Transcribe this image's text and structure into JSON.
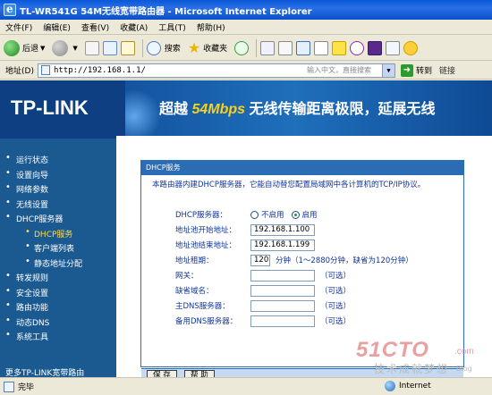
{
  "window": {
    "title": "TL-WR541G 54M无线宽带路由器 - Microsoft Internet Explorer"
  },
  "menubar": {
    "items": [
      {
        "label": "文件(F)"
      },
      {
        "label": "编辑(E)"
      },
      {
        "label": "查看(V)"
      },
      {
        "label": "收藏(A)"
      },
      {
        "label": "工具(T)"
      },
      {
        "label": "帮助(H)"
      }
    ]
  },
  "toolbar": {
    "back_label": "后退",
    "search_label": "搜索",
    "favorites_label": "收藏夹"
  },
  "addressbar": {
    "label": "地址(D)",
    "url": "http://192.168.1.1/",
    "hint": "输入中文，直接搜索",
    "go_label": "转到",
    "links_label": "链接"
  },
  "banner": {
    "logo": "TP-LINK",
    "tagline_prefix": "超越",
    "tagline_highlight": "54Mbps",
    "tagline_suffix": "无线传输距离极限，延展无线"
  },
  "sidebar": {
    "items": [
      {
        "label": "运行状态",
        "sub": false,
        "active": false
      },
      {
        "label": "设置向导",
        "sub": false,
        "active": false
      },
      {
        "label": "网络参数",
        "sub": false,
        "active": false
      },
      {
        "label": "无线设置",
        "sub": false,
        "active": false
      },
      {
        "label": "DHCP服务器",
        "sub": false,
        "active": false
      },
      {
        "label": "DHCP服务",
        "sub": true,
        "active": true
      },
      {
        "label": "客户端列表",
        "sub": true,
        "active": false
      },
      {
        "label": "静态地址分配",
        "sub": true,
        "active": false
      },
      {
        "label": "转发规则",
        "sub": false,
        "active": false
      },
      {
        "label": "安全设置",
        "sub": false,
        "active": false
      },
      {
        "label": "路由功能",
        "sub": false,
        "active": false
      },
      {
        "label": "动态DNS",
        "sub": false,
        "active": false
      },
      {
        "label": "系统工具",
        "sub": false,
        "active": false
      }
    ],
    "more": "更多TP-LINK宽带路由"
  },
  "panel": {
    "title": "DHCP服务",
    "intro": "本路由器内建DHCP服务器，它能自动替您配置局域网中各计算机的TCP/IP协议。",
    "dhcp_server": {
      "label": "DHCP服务器：",
      "off": "不启用",
      "on": "启用",
      "selected": "on"
    },
    "start_ip": {
      "label": "地址池开始地址：",
      "value": "192.168.1.100"
    },
    "end_ip": {
      "label": "地址池结束地址：",
      "value": "192.168.1.199"
    },
    "lease": {
      "label": "地址租期：",
      "value": "120",
      "note": "分钟（1～2880分钟，缺省为120分钟）"
    },
    "gateway": {
      "label": "网关：",
      "value": "",
      "note": "（可选）"
    },
    "domain": {
      "label": "缺省域名：",
      "value": "",
      "note": "（可选）"
    },
    "dns1": {
      "label": "主DNS服务器：",
      "value": "",
      "note": "（可选）"
    },
    "dns2": {
      "label": "备用DNS服务器：",
      "value": "",
      "note": "（可选）"
    },
    "save_label": "保 存",
    "help_label": "帮 助"
  },
  "statusbar": {
    "text": "完毕",
    "zone": "Internet"
  },
  "watermark": {
    "main": "51CTO",
    "com": ".com",
    "sub": "技术成就梦想",
    "blog": "Blog"
  },
  "colors": {
    "title_bar": "#0a58d8",
    "sidebar_bg": "#1b5a91",
    "panel_header": "#2a6db5",
    "active_item": "#ffd84a",
    "form_text": "#11359a"
  }
}
